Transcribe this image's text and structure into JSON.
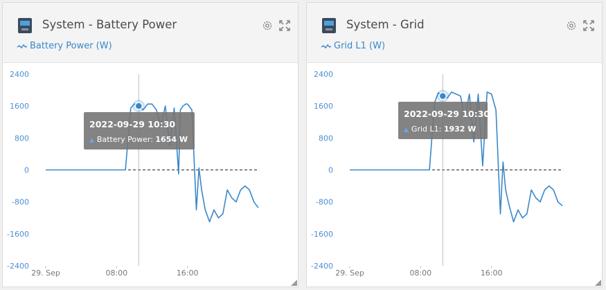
{
  "widgets": [
    {
      "title": "System - Battery Power",
      "legend": "Battery Power (W)",
      "tooltip": {
        "date": "2022-09-29 10:30",
        "series": "Battery Power",
        "value": "1654 W"
      }
    },
    {
      "title": "System - Grid",
      "legend": "Grid L1 (W)",
      "tooltip": {
        "date": "2022-09-29 10:30",
        "series": "Grid L1",
        "value": "1932 W"
      }
    }
  ],
  "colors": {
    "line": "#3a87c9",
    "axis_text": "#4d8fd0"
  },
  "icons": [
    "system-icon",
    "gear-icon",
    "expand-icon",
    "wave-icon"
  ],
  "chart_data": [
    {
      "type": "line",
      "title": "System - Battery Power",
      "ylim": [
        -2400,
        2400
      ],
      "y_ticks": [
        "2400",
        "1600",
        "800",
        "0",
        "-800",
        "-1600",
        "-2400"
      ],
      "x_ticks": [
        "29. Sep",
        "08:00",
        "16:00"
      ],
      "series": [
        {
          "name": "Battery Power (W)",
          "x": [
            0,
            1,
            2,
            3,
            4,
            5,
            6,
            7,
            8,
            9,
            9.3,
            9.6,
            10,
            10.5,
            11,
            11.5,
            12,
            12.5,
            13,
            13.5,
            14,
            14.5,
            15,
            15.2,
            15.5,
            15.8,
            16,
            16.5,
            17,
            17.3,
            17.6,
            18,
            18.5,
            19,
            19.5,
            20,
            20.5,
            21,
            21.5,
            22,
            22.5,
            23,
            23.5,
            24
          ],
          "y": [
            0,
            0,
            0,
            0,
            0,
            0,
            0,
            0,
            0,
            0,
            800,
            1550,
            1654,
            1600,
            1500,
            1650,
            1650,
            1500,
            1100,
            1600,
            600,
            1550,
            -100,
            1500,
            1600,
            1650,
            1650,
            1500,
            -1000,
            50,
            -500,
            -1000,
            -1300,
            -1000,
            -1200,
            -1100,
            -500,
            -700,
            -800,
            -500,
            -400,
            -500,
            -800,
            -950
          ]
        }
      ]
    },
    {
      "type": "line",
      "title": "System - Grid",
      "ylim": [
        -2400,
        2400
      ],
      "y_ticks": [
        "2400",
        "1600",
        "800",
        "0",
        "-800",
        "-1600",
        "-2400"
      ],
      "x_ticks": [
        "29. Sep",
        "08:00",
        "16:00"
      ],
      "series": [
        {
          "name": "Grid L1 (W)",
          "x": [
            0,
            1,
            2,
            3,
            4,
            5,
            6,
            7,
            8,
            9,
            9.3,
            9.6,
            10,
            10.5,
            11,
            11.5,
            12,
            12.5,
            13,
            13.5,
            14,
            14.5,
            15,
            15.5,
            16,
            16.5,
            17,
            17.3,
            17.6,
            18,
            18.5,
            19,
            19.5,
            20,
            20.5,
            21,
            21.5,
            22,
            22.5,
            23,
            23.5,
            24
          ],
          "y": [
            0,
            0,
            0,
            0,
            0,
            0,
            0,
            0,
            0,
            0,
            900,
            1700,
            1932,
            1850,
            1800,
            1950,
            1900,
            1850,
            1300,
            1900,
            700,
            1900,
            100,
            1950,
            1900,
            1500,
            -1100,
            200,
            -500,
            -900,
            -1300,
            -1000,
            -1200,
            -1100,
            -500,
            -700,
            -800,
            -500,
            -400,
            -500,
            -800,
            -900
          ]
        }
      ]
    }
  ]
}
